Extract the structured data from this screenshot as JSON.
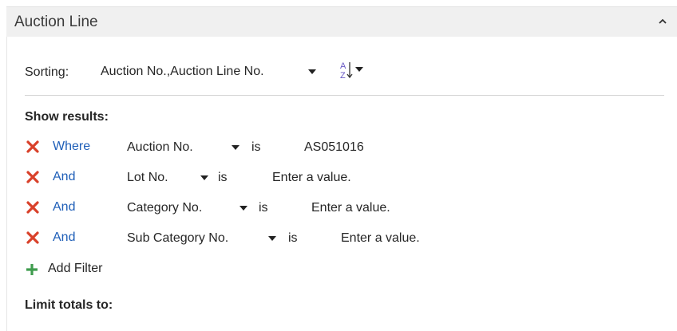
{
  "panel": {
    "title": "Auction Line",
    "collapse_icon": "chevron-up-icon"
  },
  "sorting": {
    "label": "Sorting:",
    "value": "Auction No.,Auction Line No.",
    "sort_icon": "sort-ascending-az-icon"
  },
  "show_results": {
    "label": "Show results:",
    "filters": [
      {
        "connector": "Where",
        "field": "Auction No.",
        "operator": "is",
        "value": "AS051016",
        "placeholder": false
      },
      {
        "connector": "And",
        "field": "Lot No.",
        "operator": "is",
        "value": "Enter a value.",
        "placeholder": true
      },
      {
        "connector": "And",
        "field": "Category No.",
        "operator": "is",
        "value": "Enter a value.",
        "placeholder": true
      },
      {
        "connector": "And",
        "field": "Sub Category No.",
        "operator": "is",
        "value": "Enter a value.",
        "placeholder": true
      }
    ],
    "add_filter_label": "Add Filter"
  },
  "limit_totals": {
    "label": "Limit totals to:"
  },
  "colors": {
    "remove_icon": "#d9412a",
    "add_icon": "#3f9c4e",
    "link": "#1f5fb8",
    "header_bg": "#f0f0f0"
  }
}
